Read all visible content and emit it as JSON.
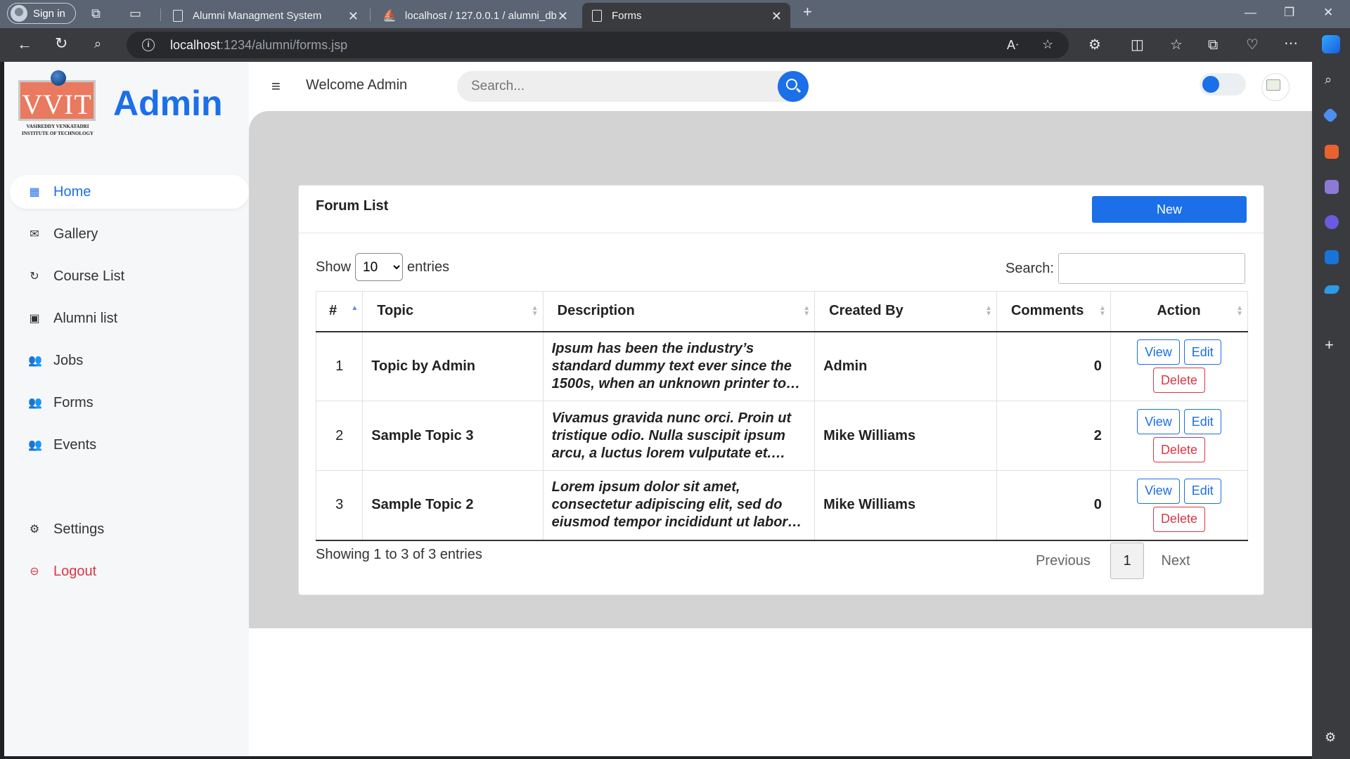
{
  "browser": {
    "signin_label": "Sign in",
    "tabs": [
      {
        "title": "Alumni Managment System"
      },
      {
        "title": "localhost / 127.0.0.1 / alumni_db"
      },
      {
        "title": "Forms"
      }
    ],
    "url_host": "localhost",
    "url_rest": ":1234/alumni/forms.jsp"
  },
  "sidebar": {
    "logo_text": "VVIT",
    "logo_line1": "VASIREDDY VENKATADRI",
    "logo_line2": "INSTITUTE OF TECHNOLOGY",
    "brand": "Admin",
    "items": [
      {
        "label": "Home",
        "icon": "grid-icon"
      },
      {
        "label": "Gallery",
        "icon": "envelope-icon"
      },
      {
        "label": "Course List",
        "icon": "refresh-icon"
      },
      {
        "label": "Alumni list",
        "icon": "chat-icon"
      },
      {
        "label": "Jobs",
        "icon": "users-icon"
      },
      {
        "label": "Forms",
        "icon": "users-icon"
      },
      {
        "label": "Events",
        "icon": "users-icon"
      },
      {
        "label": "Settings",
        "icon": "gear-icon"
      },
      {
        "label": "Logout",
        "icon": "minus-circle-icon"
      }
    ]
  },
  "header": {
    "welcome": "Welcome Admin",
    "search_placeholder": "Search..."
  },
  "forum": {
    "title": "Forum List",
    "new_label": "New",
    "show_label": "Show",
    "entries_label": "entries",
    "page_size": "10",
    "search_label": "Search:",
    "columns": [
      "#",
      "Topic",
      "Description",
      "Created By",
      "Comments",
      "Action"
    ],
    "rows": [
      {
        "idx": "1",
        "topic": "Topic by Admin",
        "description": "Ipsum has been the industry’s standard dummy text ever since the 1500s, when an unknown printer took a galley of type and scrambled it",
        "created_by": "Admin",
        "comments": "0"
      },
      {
        "idx": "2",
        "topic": "Sample Topic 3",
        "description": "Vivamus gravida nunc orci. Proin ut tristique odio. Nulla suscipit ipsum arcu, a luctus lorem vulputate et. Maecenas sodales",
        "created_by": "Mike Williams",
        "comments": "2"
      },
      {
        "idx": "3",
        "topic": "Sample Topic 2",
        "description": "Lorem ipsum dolor sit amet, consectetur adipiscing elit, sed do eiusmod tempor incididunt ut labore et dolore magna aliqua",
        "created_by": "Mike Williams",
        "comments": "0"
      }
    ],
    "actions": {
      "view": "View",
      "edit": "Edit",
      "delete": "Delete"
    },
    "info": "Showing 1 to 3 of 3 entries",
    "pager": {
      "prev": "Previous",
      "current": "1",
      "next": "Next"
    }
  },
  "colors": {
    "accent": "#1b6fe8",
    "danger": "#dc3545",
    "content_bg": "#d3d3d3"
  }
}
